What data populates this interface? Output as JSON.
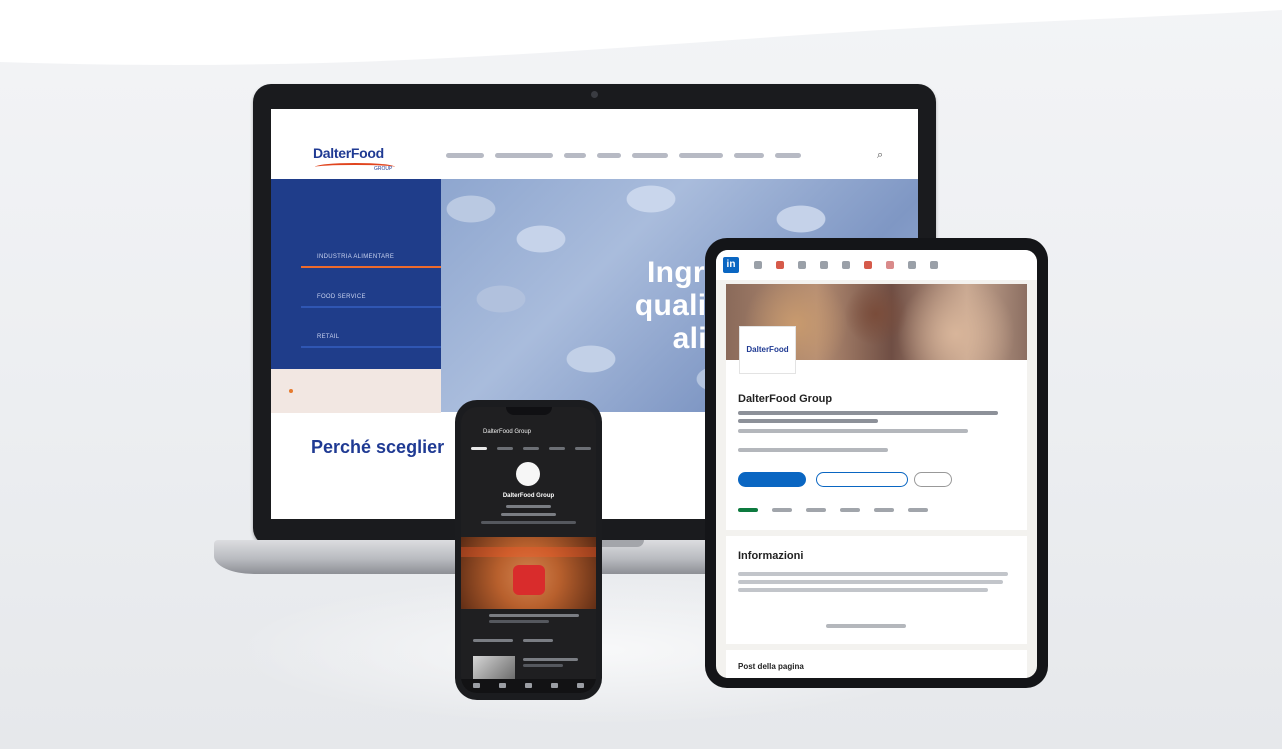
{
  "laptop": {
    "logo": "DalterFood",
    "logo_sub": "GROUP",
    "search_icon": "magnifier-icon",
    "menu": [
      "INDUSTRIA ALIMENTARE",
      "FOOD SERVICE",
      "RETAIL"
    ],
    "hero_title_lines": [
      "Ingredient",
      "qualità per l",
      "alimen"
    ],
    "section_title": "Perché sceglier"
  },
  "tablet": {
    "app_icon": "linkedin-logo-icon",
    "linkedin_mark": "in",
    "avatar_text": "DalterFood",
    "company_name": "DalterFood Group",
    "info_title": "Informazioni",
    "post_title": "Post della pagina"
  },
  "phone": {
    "channel_title": "DalterFood Group",
    "channel_name": "DalterFood Group"
  },
  "colors": {
    "brand_blue": "#1f3a93",
    "accent_orange": "#ee6b2c",
    "linkedin_blue": "#0a66c2"
  }
}
